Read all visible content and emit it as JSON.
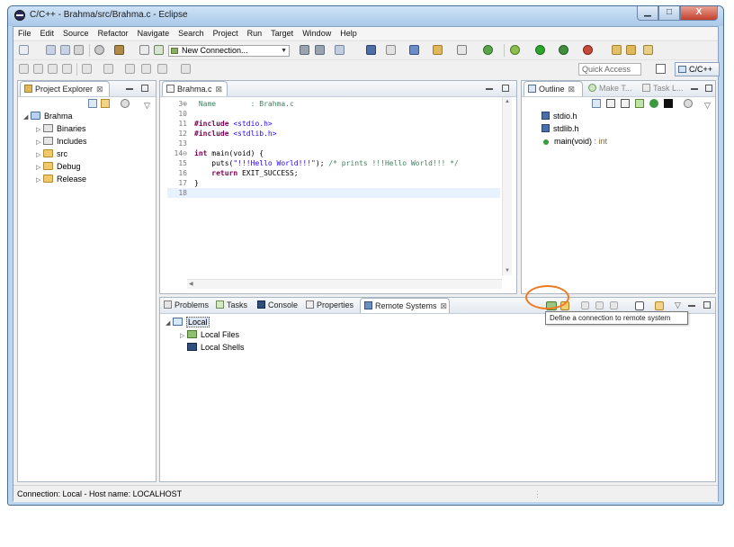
{
  "window": {
    "title": "C/C++ - Brahma/src/Brahma.c - Eclipse",
    "min": "▁",
    "max": "□",
    "close": "X"
  },
  "menu": [
    "File",
    "Edit",
    "Source",
    "Refactor",
    "Navigate",
    "Search",
    "Project",
    "Run",
    "Target",
    "Window",
    "Help"
  ],
  "toolbar": {
    "connection_combo": "New Connection...",
    "quick_access": "Quick Access",
    "perspective": "C/C++"
  },
  "project_explorer": {
    "tab_label": "Project Explorer",
    "close": "⊠",
    "items": [
      {
        "label": "Brahma",
        "twisty": "◢"
      },
      {
        "label": "Binaries",
        "twisty": "▷"
      },
      {
        "label": "Includes",
        "twisty": "▷"
      },
      {
        "label": "src",
        "twisty": "▷"
      },
      {
        "label": "Debug",
        "twisty": "▷"
      },
      {
        "label": "Release",
        "twisty": "▷"
      }
    ]
  },
  "editor": {
    "tab_label": "Brahma.c",
    "close": "⊠",
    "lines": [
      {
        "n": "3⊕",
        "text": " Name        : Brahma.c"
      },
      {
        "n": "10",
        "text": ""
      },
      {
        "n": "11",
        "pre": "#include ",
        "inc": "<stdio.h>"
      },
      {
        "n": "12",
        "pre": "#include ",
        "inc": "<stdlib.h>"
      },
      {
        "n": "13",
        "text": ""
      },
      {
        "n": "14⊖",
        "kw": "int",
        "text": " main(void) {"
      },
      {
        "n": "15",
        "pre": "    puts(",
        "str": "\"!!!Hello World!!!\"",
        "post": "); ",
        "cm": "/* prints !!!Hello World!!! */"
      },
      {
        "n": "16",
        "kw": "    return",
        "text": " EXIT_SUCCESS;"
      },
      {
        "n": "17",
        "text": "}"
      },
      {
        "n": "18",
        "text": ""
      }
    ]
  },
  "outline": {
    "tabs": [
      "Outline",
      "Make T...",
      "Task L..."
    ],
    "close": "⊠",
    "items": [
      "stdio.h",
      "stdlib.h",
      "main(void)"
    ],
    "main_type": " : int"
  },
  "bottom": {
    "tabs": [
      "Problems",
      "Tasks",
      "Console",
      "Properties",
      "Remote Systems"
    ],
    "close": "⊠",
    "tree": [
      {
        "label": "Local",
        "twisty": "◢"
      },
      {
        "label": "Local Files",
        "twisty": "▷"
      },
      {
        "label": "Local Shells",
        "twisty": ""
      }
    ],
    "tooltip": "Define a connection to remote system"
  },
  "status": {
    "text": "Connection: Local  -  Host name: LOCALHOST"
  },
  "colors": {
    "accent_highlight": "#f07a22",
    "frame": "#bcd6ee"
  }
}
